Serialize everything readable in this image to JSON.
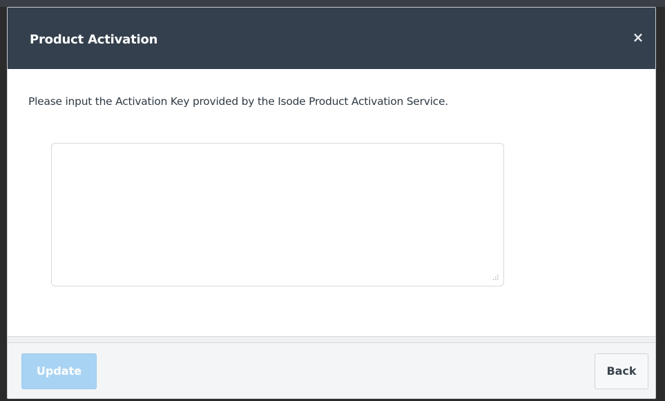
{
  "dialog": {
    "title": "Product Activation",
    "close_symbol": "×",
    "close_icon": "close-icon"
  },
  "body": {
    "instruction": "Please input the Activation Key provided by the Isode Product Activation Service.",
    "activation_key": {
      "value": "",
      "placeholder": ""
    }
  },
  "footer": {
    "update_label": "Update",
    "update_state": "disabled",
    "back_label": "Back"
  },
  "colors": {
    "header_bg": "#34404d",
    "update_button_bg": "#a9d3f3",
    "footer_bg": "#f4f5f6"
  }
}
